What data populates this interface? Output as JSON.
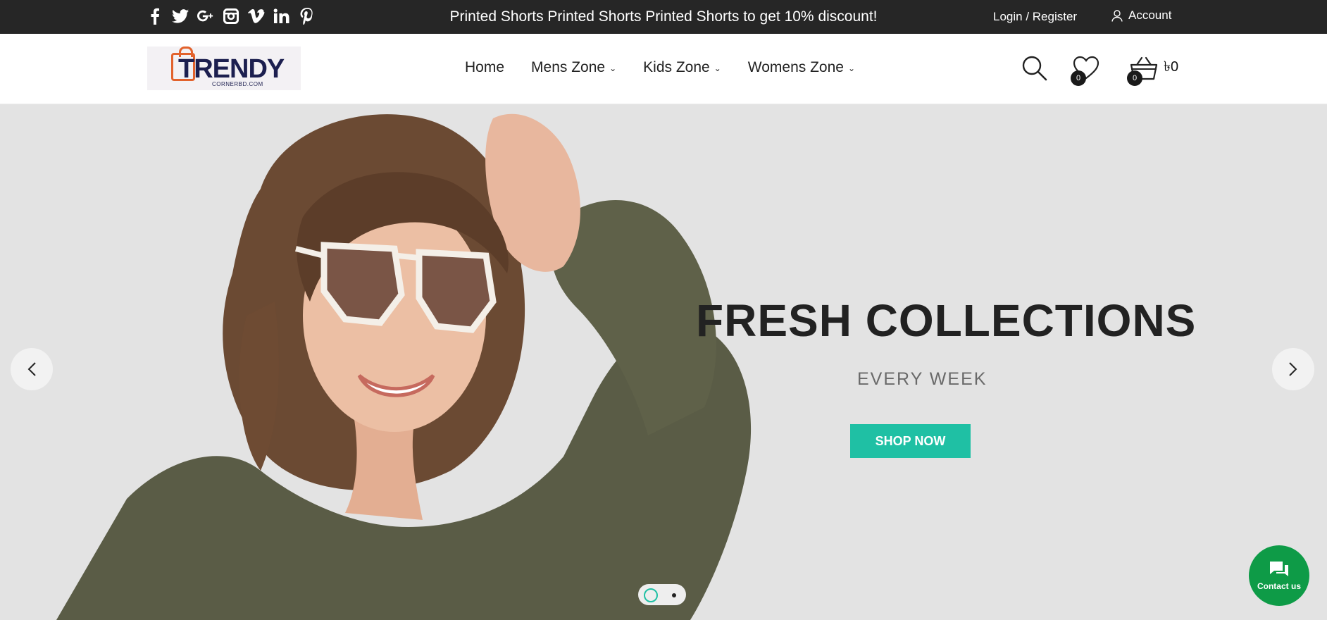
{
  "topbar": {
    "social": [
      "facebook-icon",
      "twitter-icon",
      "google-plus-icon",
      "instagram-icon",
      "vimeo-icon",
      "linkedin-icon",
      "pinterest-icon"
    ],
    "promo_text": "Printed Shorts Printed Shorts Printed Shorts to get 10% discount!",
    "auth_label": "Login / Register",
    "account_label": "Account"
  },
  "header": {
    "logo_text": "TRENDY",
    "logo_sub": "CORNERBD.COM",
    "nav": [
      {
        "label": "Home"
      },
      {
        "label": "Mens Zone"
      },
      {
        "label": "Kids Zone"
      },
      {
        "label": "Womens Zone"
      }
    ],
    "wishlist_count": "0",
    "cart_count": "0",
    "cart_total": "৳0"
  },
  "hero": {
    "headline": "FRESH COLLECTIONS",
    "subline": "EVERY WEEK",
    "cta_label": "SHOP NOW"
  },
  "contact": {
    "label": "Contact us"
  },
  "colors": {
    "topbar_bg": "#262626",
    "accent": "#1fc0a4",
    "contact_bg": "#0e9b47",
    "hero_bg": "#e3e3e3"
  }
}
